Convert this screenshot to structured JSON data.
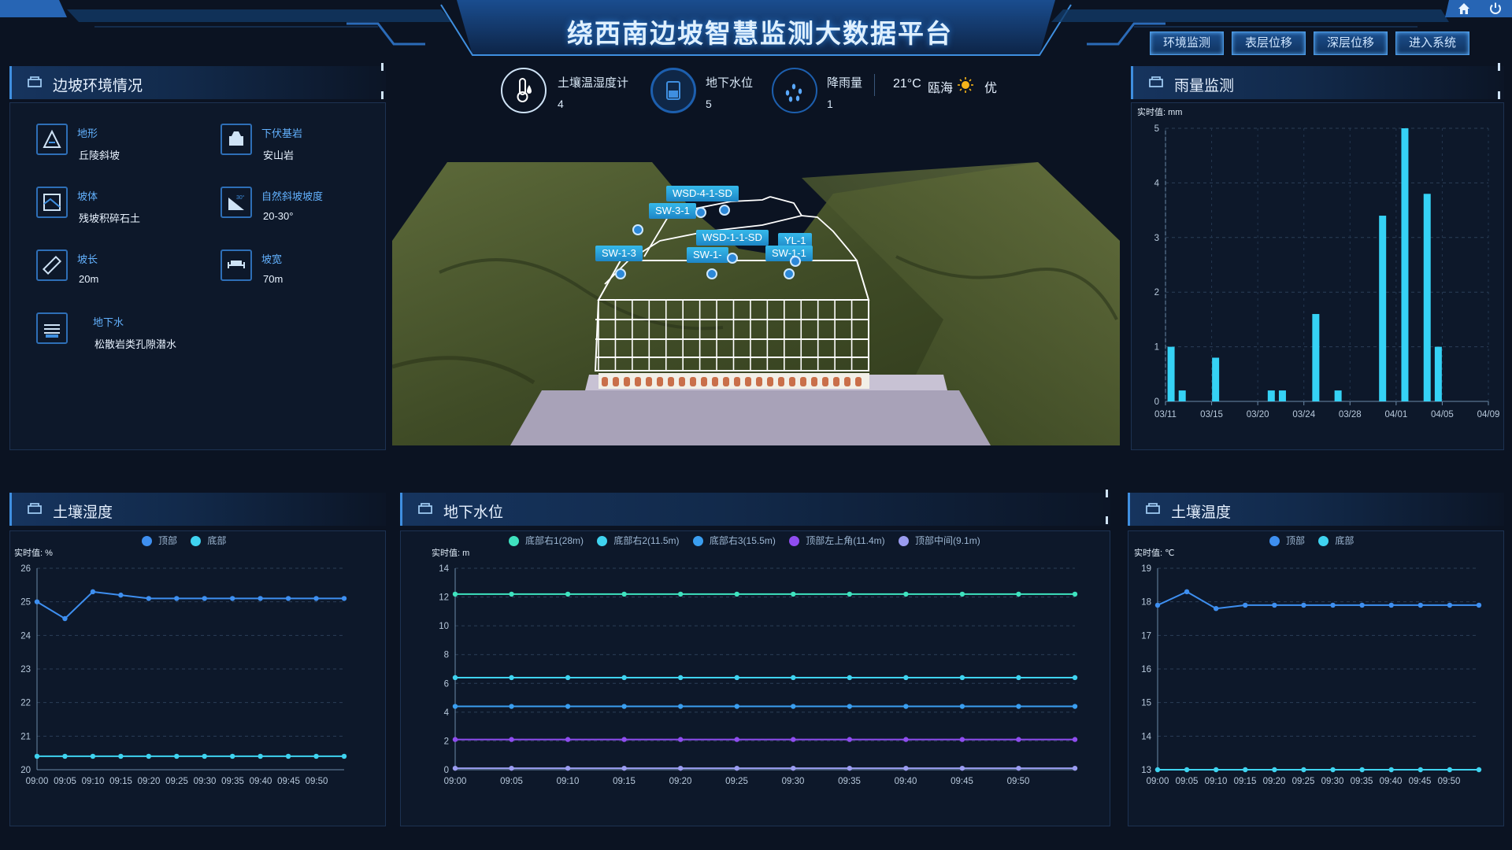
{
  "header": {
    "title": "绕西南边坡智慧监测大数据平台",
    "nav": [
      "环境监测",
      "表层位移",
      "深层位移",
      "进入系统"
    ]
  },
  "stats": [
    {
      "label": "土壤温湿度计",
      "value": "4",
      "icon": "thermometer-icon"
    },
    {
      "label": "地下水位",
      "value": "5",
      "icon": "water-level-icon"
    },
    {
      "label": "降雨量",
      "value": "1",
      "icon": "rain-icon"
    }
  ],
  "weather": {
    "temp": "21°C",
    "city": "瓯海",
    "quality": "优"
  },
  "env": {
    "title": "边坡环境情况",
    "items": [
      {
        "label": "地形",
        "value": "丘陵斜坡"
      },
      {
        "label": "下伏基岩",
        "value": "安山岩"
      },
      {
        "label": "坡体",
        "value": "残坡积碎石土"
      },
      {
        "label": "自然斜坡坡度",
        "value": "20-30°"
      },
      {
        "label": "坡长",
        "value": "20m"
      },
      {
        "label": "坡宽",
        "value": "70m"
      },
      {
        "label": "地下水",
        "value": "松散岩类孔隙潜水"
      }
    ]
  },
  "model": {
    "tags": [
      "WSD-4-1-SD",
      "SW-3-1",
      "WSD-1-1-SD",
      "YL-1",
      "SW-1-3",
      "SW-1-",
      "SW-1-1"
    ]
  },
  "rain": {
    "title": "雨量监测",
    "unit_label": "实时值: mm"
  },
  "humidity": {
    "title": "土壤湿度",
    "unit_label": "实时值: %"
  },
  "groundwater": {
    "title": "地下水位",
    "unit_label": "实时值: m"
  },
  "temperature": {
    "title": "土壤温度",
    "unit_label": "实时值: ℃"
  },
  "colors": {
    "accent": "#3f8fe0",
    "bar": "#35d2f5",
    "top": "#3e8ff0",
    "bottom": "#3fd3f0"
  },
  "chart_data": [
    {
      "id": "rain",
      "type": "bar",
      "x_ticks": [
        "03/11",
        "03/15",
        "03/20",
        "03/24",
        "03/28",
        "04/01",
        "04/05",
        "04/09"
      ],
      "x_range": [
        0,
        29
      ],
      "ylim": [
        0,
        5
      ],
      "y_ticks": [
        0,
        1,
        2,
        3,
        4,
        5
      ],
      "points": [
        {
          "x": 0.5,
          "y": 1.0
        },
        {
          "x": 1.5,
          "y": 0.2
        },
        {
          "x": 4.5,
          "y": 0.8
        },
        {
          "x": 9.5,
          "y": 0.2
        },
        {
          "x": 10.5,
          "y": 0.2
        },
        {
          "x": 13.5,
          "y": 1.6
        },
        {
          "x": 15.5,
          "y": 0.2
        },
        {
          "x": 19.5,
          "y": 3.4
        },
        {
          "x": 21.5,
          "y": 5.0
        },
        {
          "x": 23.5,
          "y": 3.8
        },
        {
          "x": 24.5,
          "y": 1.0
        }
      ]
    },
    {
      "id": "humidity",
      "type": "line",
      "legend": [
        "顶部",
        "底部"
      ],
      "categories": [
        "09:00",
        "09:05",
        "09:10",
        "09:15",
        "09:20",
        "09:25",
        "09:30",
        "09:35",
        "09:40",
        "09:45",
        "09:50"
      ],
      "ylim": [
        20,
        26
      ],
      "y_ticks": [
        20,
        21,
        22,
        23,
        24,
        25,
        26
      ],
      "series": [
        {
          "name": "顶部",
          "values": [
            25.0,
            24.5,
            25.3,
            25.2,
            25.1,
            25.1,
            25.1,
            25.1,
            25.1,
            25.1,
            25.1,
            25.1
          ]
        },
        {
          "name": "底部",
          "values": [
            20.4,
            20.4,
            20.4,
            20.4,
            20.4,
            20.4,
            20.4,
            20.4,
            20.4,
            20.4,
            20.4,
            20.4
          ]
        }
      ]
    },
    {
      "id": "groundwater",
      "type": "line",
      "legend": [
        "底部右1(28m)",
        "底部右2(11.5m)",
        "底部右3(15.5m)",
        "顶部左上角(11.4m)",
        "顶部中间(9.1m)"
      ],
      "categories": [
        "09:00",
        "09:05",
        "09:10",
        "09:15",
        "09:20",
        "09:25",
        "09:30",
        "09:35",
        "09:40",
        "09:45",
        "09:50"
      ],
      "ylim": [
        0,
        14
      ],
      "y_ticks": [
        0,
        2,
        4,
        6,
        8,
        10,
        12,
        14
      ],
      "series": [
        {
          "name": "底部右1(28m)",
          "values": [
            12.2,
            12.2,
            12.2,
            12.2,
            12.2,
            12.2,
            12.2,
            12.2,
            12.2,
            12.2,
            12.2,
            12.2
          ]
        },
        {
          "name": "底部右2(11.5m)",
          "values": [
            6.4,
            6.4,
            6.4,
            6.4,
            6.4,
            6.4,
            6.4,
            6.4,
            6.4,
            6.4,
            6.4,
            6.4
          ]
        },
        {
          "name": "底部右3(15.5m)",
          "values": [
            4.4,
            4.4,
            4.4,
            4.4,
            4.4,
            4.4,
            4.4,
            4.4,
            4.4,
            4.4,
            4.4,
            4.4
          ]
        },
        {
          "name": "顶部左上角(11.4m)",
          "values": [
            2.1,
            2.1,
            2.1,
            2.1,
            2.1,
            2.1,
            2.1,
            2.1,
            2.1,
            2.1,
            2.1,
            2.1
          ]
        },
        {
          "name": "顶部中间(9.1m)",
          "values": [
            0.1,
            0.1,
            0.1,
            0.1,
            0.1,
            0.1,
            0.1,
            0.1,
            0.1,
            0.1,
            0.1,
            0.1
          ]
        }
      ]
    },
    {
      "id": "temperature",
      "type": "line",
      "legend": [
        "顶部",
        "底部"
      ],
      "categories": [
        "09:00",
        "09:05",
        "09:10",
        "09:15",
        "09:20",
        "09:25",
        "09:30",
        "09:35",
        "09:40",
        "09:45",
        "09:50"
      ],
      "ylim": [
        13,
        19
      ],
      "y_ticks": [
        13,
        14,
        15,
        16,
        17,
        18,
        19
      ],
      "series": [
        {
          "name": "顶部",
          "values": [
            17.9,
            18.3,
            17.8,
            17.9,
            17.9,
            17.9,
            17.9,
            17.9,
            17.9,
            17.9,
            17.9,
            17.9
          ]
        },
        {
          "name": "底部",
          "values": [
            13.0,
            13.0,
            13.0,
            13.0,
            13.0,
            13.0,
            13.0,
            13.0,
            13.0,
            13.0,
            13.0,
            13.0
          ]
        }
      ]
    }
  ]
}
